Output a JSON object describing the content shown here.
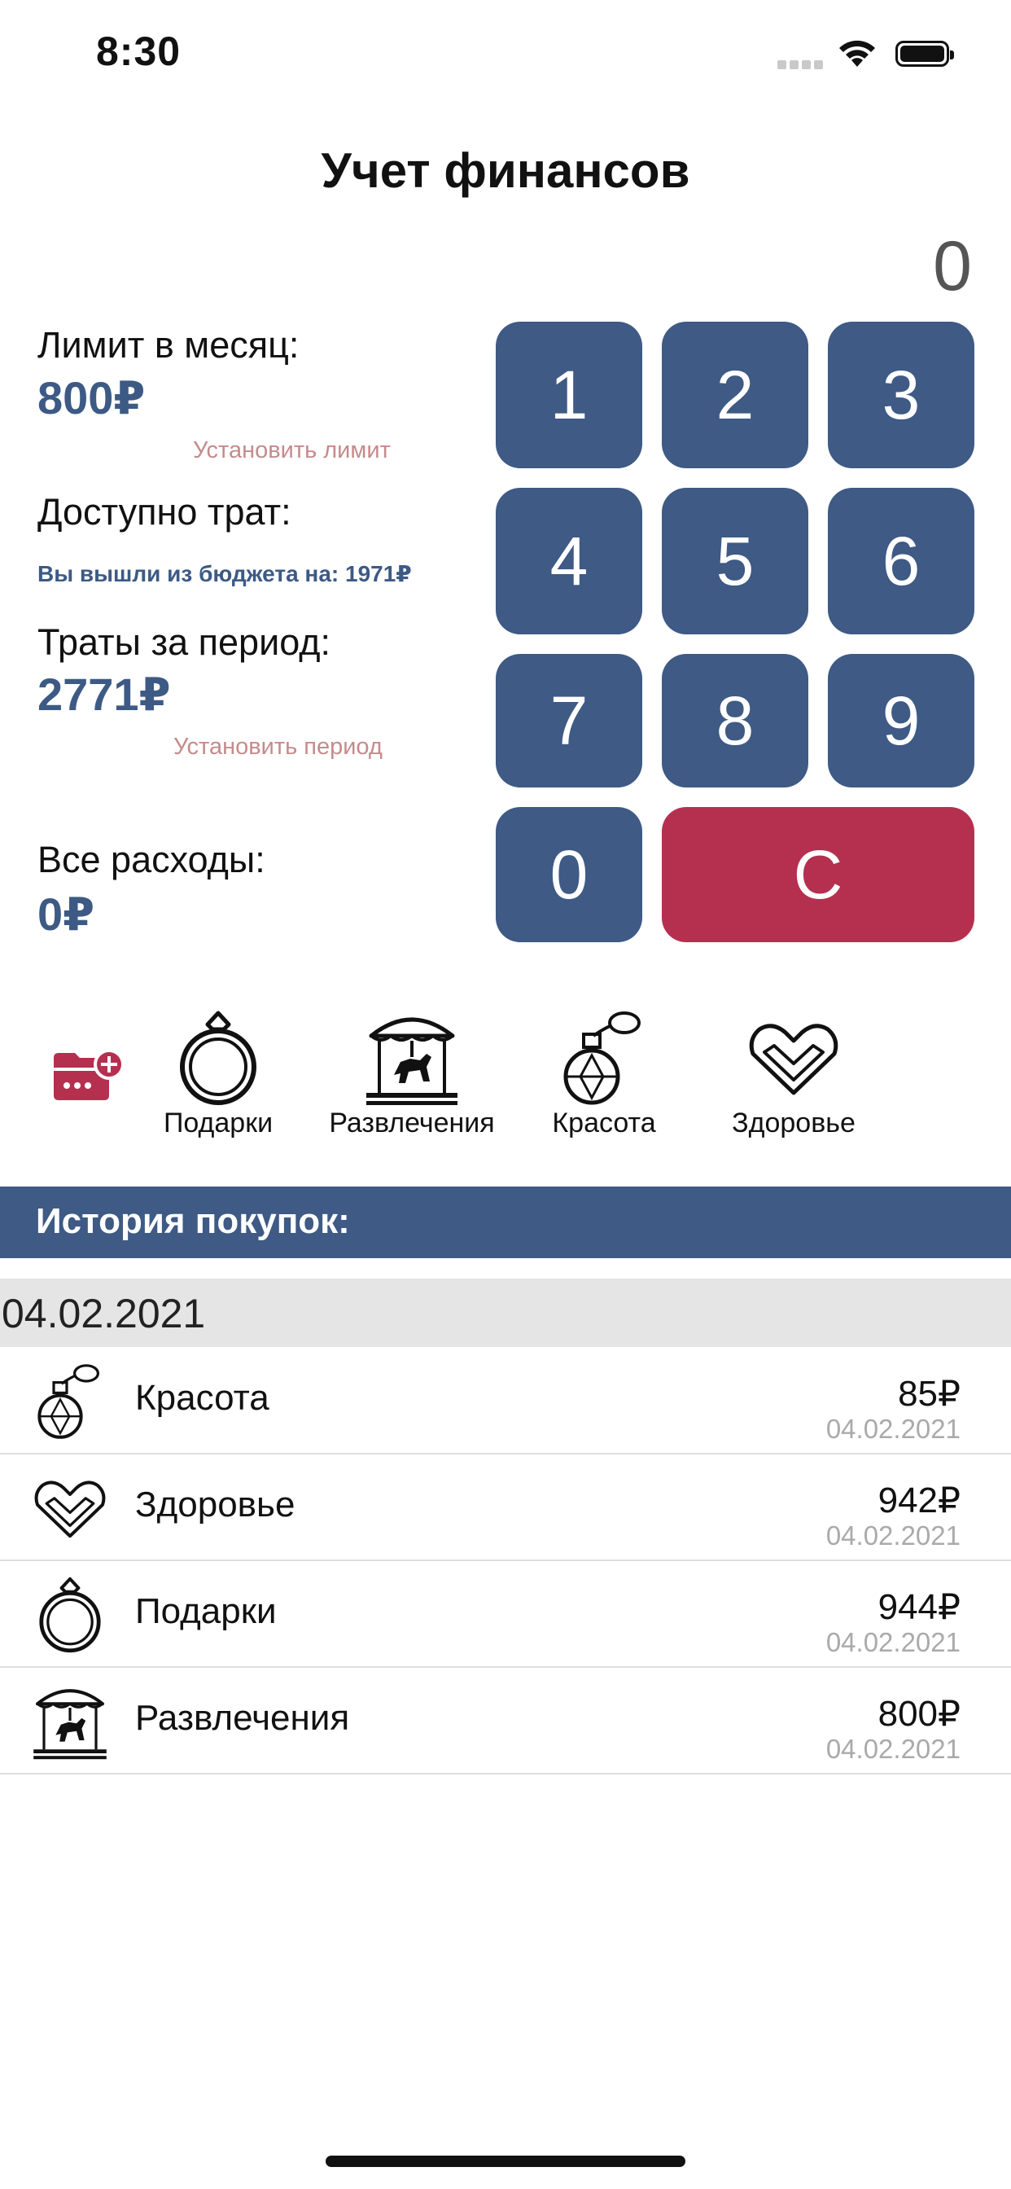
{
  "status_bar": {
    "time": "8:30"
  },
  "header": {
    "title": "Учет финансов",
    "display_value": "0"
  },
  "info": {
    "limit_label": "Лимит в месяц:",
    "limit_value": "800₽",
    "set_limit_link": "Установить лимит",
    "available_label": "Доступно трат:",
    "over_budget_text": "Вы вышли из бюджета на: 1971₽",
    "period_label": "Траты за период:",
    "period_value": "2771₽",
    "set_period_link": "Установить период",
    "total_label": "Все расходы:",
    "total_value": "0₽"
  },
  "keypad": {
    "k1": "1",
    "k2": "2",
    "k3": "3",
    "k4": "4",
    "k5": "5",
    "k6": "6",
    "k7": "7",
    "k8": "8",
    "k9": "9",
    "k0": "0",
    "clear": "C"
  },
  "categories": [
    {
      "label": "Подарки",
      "icon": "ring-icon"
    },
    {
      "label": "Развлечения",
      "icon": "carousel-icon"
    },
    {
      "label": "Красота",
      "icon": "perfume-icon"
    },
    {
      "label": "Здоровье",
      "icon": "heart-icon"
    }
  ],
  "add_category_icon": "add-category-icon",
  "history": {
    "title": "История покупок:",
    "group_date": "04.02.2021",
    "rows": [
      {
        "name": "Красота",
        "amount": "85₽",
        "date": "04.02.2021",
        "icon": "perfume-icon"
      },
      {
        "name": "Здоровье",
        "amount": "942₽",
        "date": "04.02.2021",
        "icon": "heart-icon"
      },
      {
        "name": "Подарки",
        "amount": "944₽",
        "date": "04.02.2021",
        "icon": "ring-icon"
      },
      {
        "name": "Развлечения",
        "amount": "800₽",
        "date": "04.02.2021",
        "icon": "carousel-icon"
      }
    ]
  },
  "colors": {
    "primary": "#3e5a85",
    "danger": "#b5304f",
    "link": "#c58b8b"
  }
}
